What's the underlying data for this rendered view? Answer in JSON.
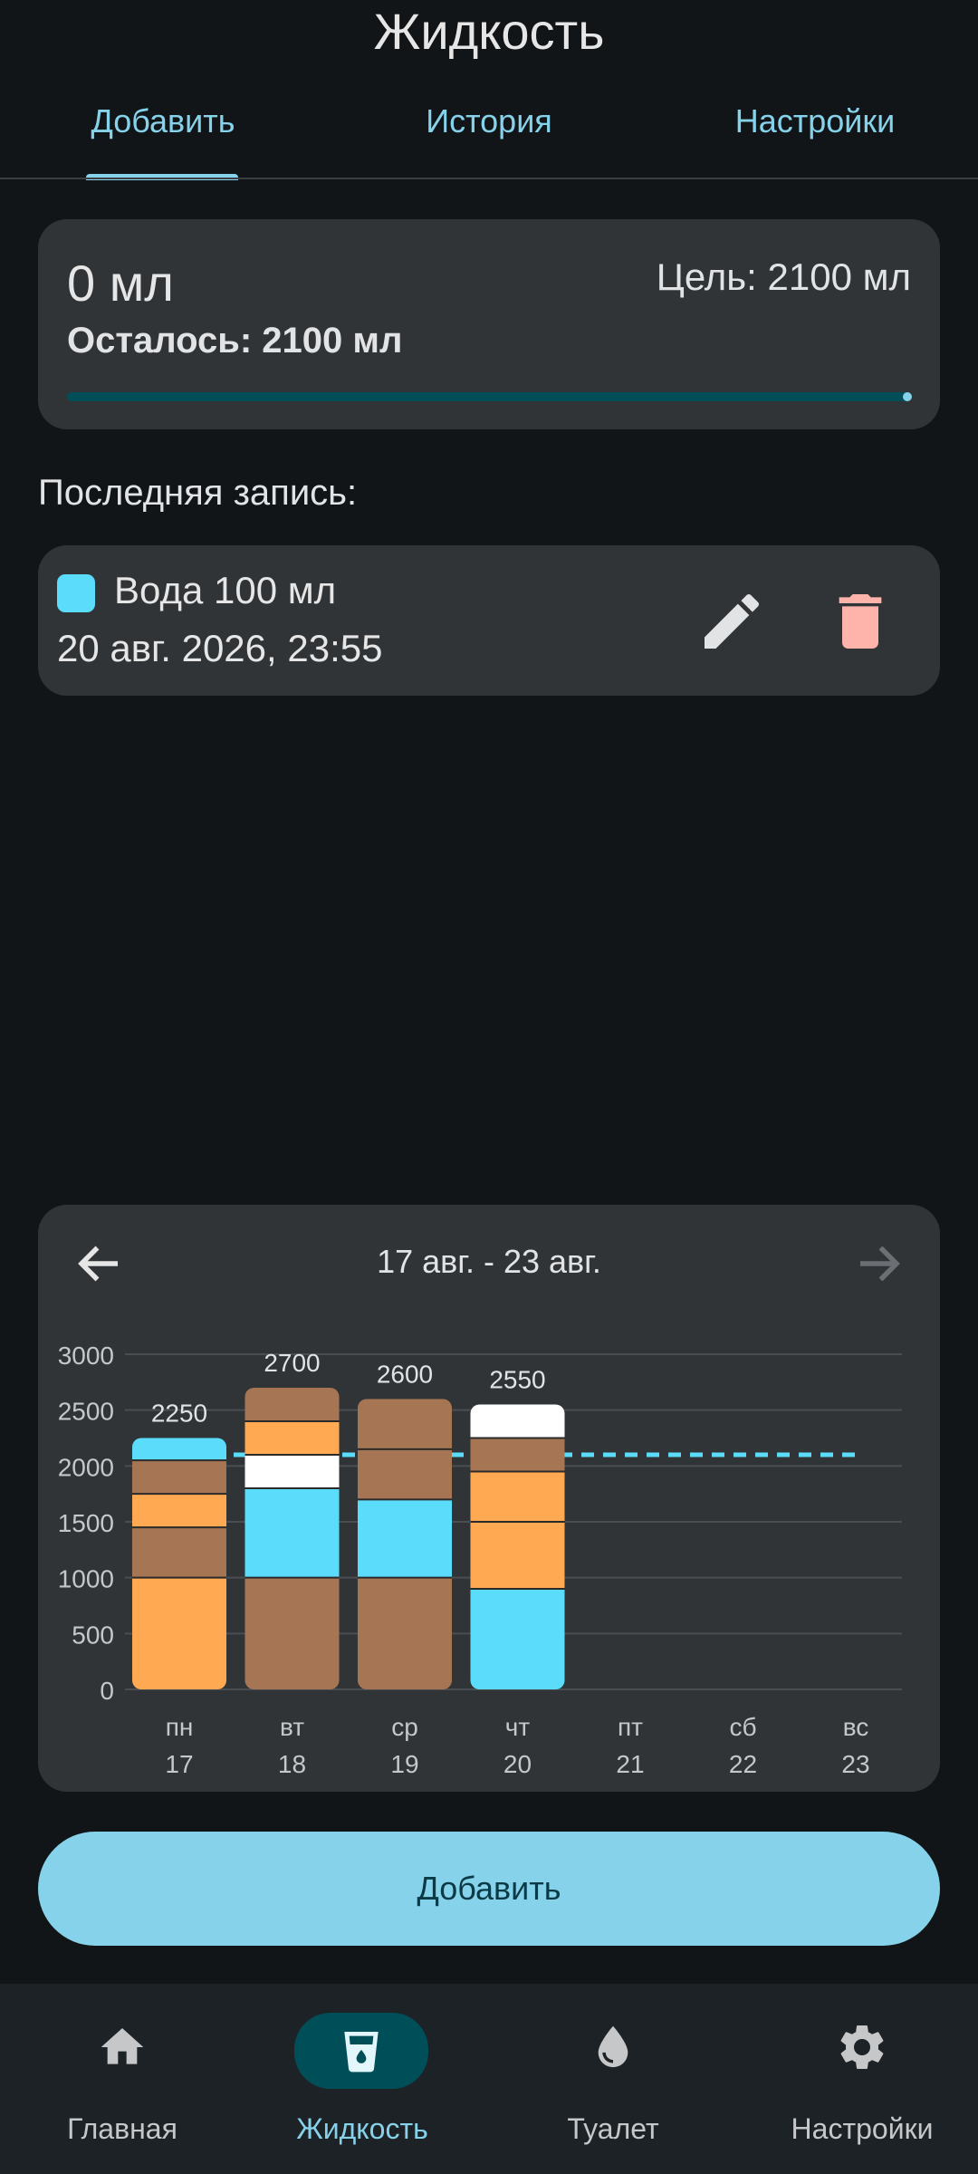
{
  "header": {
    "title": "Жидкость"
  },
  "tabs": [
    {
      "label": "Добавить",
      "active": true
    },
    {
      "label": "История"
    },
    {
      "label": "Настройки"
    }
  ],
  "summary": {
    "amount": "0 мл",
    "goal": "Цель: 2100 мл",
    "remaining": "Осталось: 2100 мл",
    "progress": 0
  },
  "last_entry": {
    "label": "Последняя запись:",
    "name": "Вода 100 мл",
    "date": "20 авг. 2026, 23:55",
    "swatch_color": "#5adcfa",
    "edit_icon": "pencil-icon",
    "delete_icon": "trash-icon"
  },
  "chart_data": {
    "type": "bar",
    "stacked": true,
    "week_label": "17 авг. - 23 авг.",
    "categories": [
      "пн\n17",
      "вт\n18",
      "ср\n19",
      "чт\n20",
      "пт\n21",
      "сб\n22",
      "вс\n23"
    ],
    "day_names": [
      "пн",
      "вт",
      "ср",
      "чт",
      "пт",
      "сб",
      "вс"
    ],
    "day_numbers": [
      "17",
      "18",
      "19",
      "20",
      "21",
      "22",
      "23"
    ],
    "y_ticks": [
      0,
      500,
      1000,
      1500,
      2000,
      2500,
      3000
    ],
    "ylim": [
      0,
      3000
    ],
    "goal_line": 2100,
    "totals": [
      2250,
      2700,
      2600,
      2550,
      null,
      null,
      null
    ],
    "total_labels": [
      "2250",
      "2700",
      "2600",
      "2550",
      "",
      "",
      ""
    ],
    "stacks": [
      [
        {
          "value": 1000,
          "color": "#ffa952"
        },
        {
          "value": 450,
          "color": "#a67654"
        },
        {
          "value": 300,
          "color": "#ffa952"
        },
        {
          "value": 300,
          "color": "#a67654"
        },
        {
          "value": 200,
          "color": "#5adcfa"
        }
      ],
      [
        {
          "value": 1000,
          "color": "#a67654"
        },
        {
          "value": 800,
          "color": "#5adcfa"
        },
        {
          "value": 300,
          "color": "#ffffff"
        },
        {
          "value": 300,
          "color": "#ffa952"
        },
        {
          "value": 300,
          "color": "#a67654"
        }
      ],
      [
        {
          "value": 1000,
          "color": "#a67654"
        },
        {
          "value": 700,
          "color": "#5adcfa"
        },
        {
          "value": 450,
          "color": "#a67654"
        },
        {
          "value": 450,
          "color": "#a67654"
        }
      ],
      [
        {
          "value": 900,
          "color": "#5adcfa"
        },
        {
          "value": 600,
          "color": "#ffa952"
        },
        {
          "value": 450,
          "color": "#ffa952"
        },
        {
          "value": 300,
          "color": "#a67654"
        },
        {
          "value": 300,
          "color": "#ffffff"
        }
      ],
      [],
      [],
      []
    ],
    "colors": {
      "goal": "#5adcfa",
      "grid": "#4a4e52",
      "text": "#c5c7c9"
    }
  },
  "add_button": {
    "label": "Добавить"
  },
  "bottom_nav": [
    {
      "label": "Главная",
      "icon": "home-icon"
    },
    {
      "label": "Жидкость",
      "icon": "cup-icon",
      "active": true
    },
    {
      "label": "Туалет",
      "icon": "drop-icon"
    },
    {
      "label": "Настройки",
      "icon": "gear-icon"
    }
  ],
  "colors": {
    "accent": "#86d2ea",
    "background": "#111518",
    "card": "#303437"
  }
}
